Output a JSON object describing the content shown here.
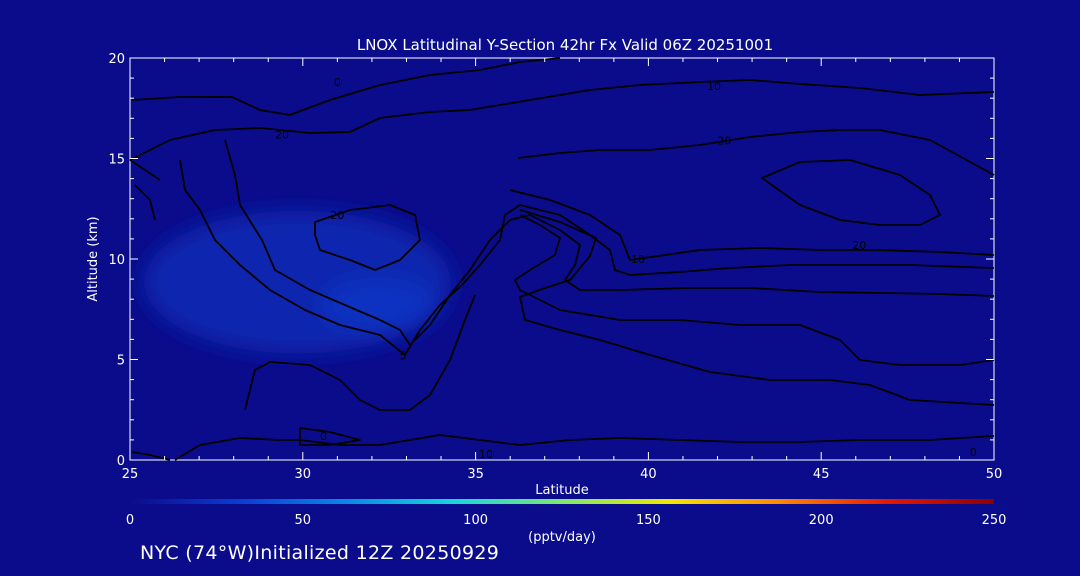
{
  "chart_data": {
    "type": "contour",
    "title": "LNOX Latitudinal Y-Section 42hr  Fx Valid 06Z 20251001",
    "xlabel": "Latitude",
    "ylabel": "Altitude (km)",
    "xlim": [
      25,
      50
    ],
    "ylim": [
      0,
      20
    ],
    "x_ticks": [
      25,
      30,
      35,
      40,
      45,
      50
    ],
    "y_ticks": [
      0,
      5,
      10,
      15,
      20
    ],
    "contour_labels": [
      {
        "text": "10",
        "lat": 41.9,
        "alt": 18.6
      },
      {
        "text": "20",
        "lat": 42.2,
        "alt": 15.9
      },
      {
        "text": "20",
        "lat": 29.4,
        "alt": 16.2
      },
      {
        "text": "20",
        "lat": 31.0,
        "alt": 12.2
      },
      {
        "text": "10",
        "lat": 39.7,
        "alt": 10.0
      },
      {
        "text": "20",
        "lat": 46.1,
        "alt": 10.7
      },
      {
        "text": "0",
        "lat": 31.0,
        "alt": 18.8
      },
      {
        "text": "5",
        "lat": 32.9,
        "alt": 5.2
      },
      {
        "text": "0",
        "lat": 30.6,
        "alt": 1.2
      },
      {
        "text": "10",
        "lat": 35.3,
        "alt": 0.3
      },
      {
        "text": "0",
        "lat": 49.4,
        "alt": 0.4
      }
    ],
    "colorbar": {
      "label": "(pptv/day)",
      "range": [
        0,
        250
      ],
      "ticks": [
        0,
        50,
        100,
        150,
        200,
        250
      ],
      "colors": [
        "#0a0c8c",
        "#0a3cd0",
        "#0a88e8",
        "#19d6d8",
        "#7fe870",
        "#f2e600",
        "#ff8a00",
        "#e41a00",
        "#8c0000"
      ]
    },
    "shaded_regions": [
      {
        "value": 18,
        "lat_range": [
          25.4,
          34.3
        ],
        "alt_range": [
          5.3,
          12.4
        ]
      },
      {
        "value": 25,
        "lat_range": [
          30.5,
          33.9
        ],
        "alt_range": [
          6.3,
          9.1
        ]
      }
    ]
  },
  "footer_text": "NYC (74°W)Initialized 12Z 20250929"
}
